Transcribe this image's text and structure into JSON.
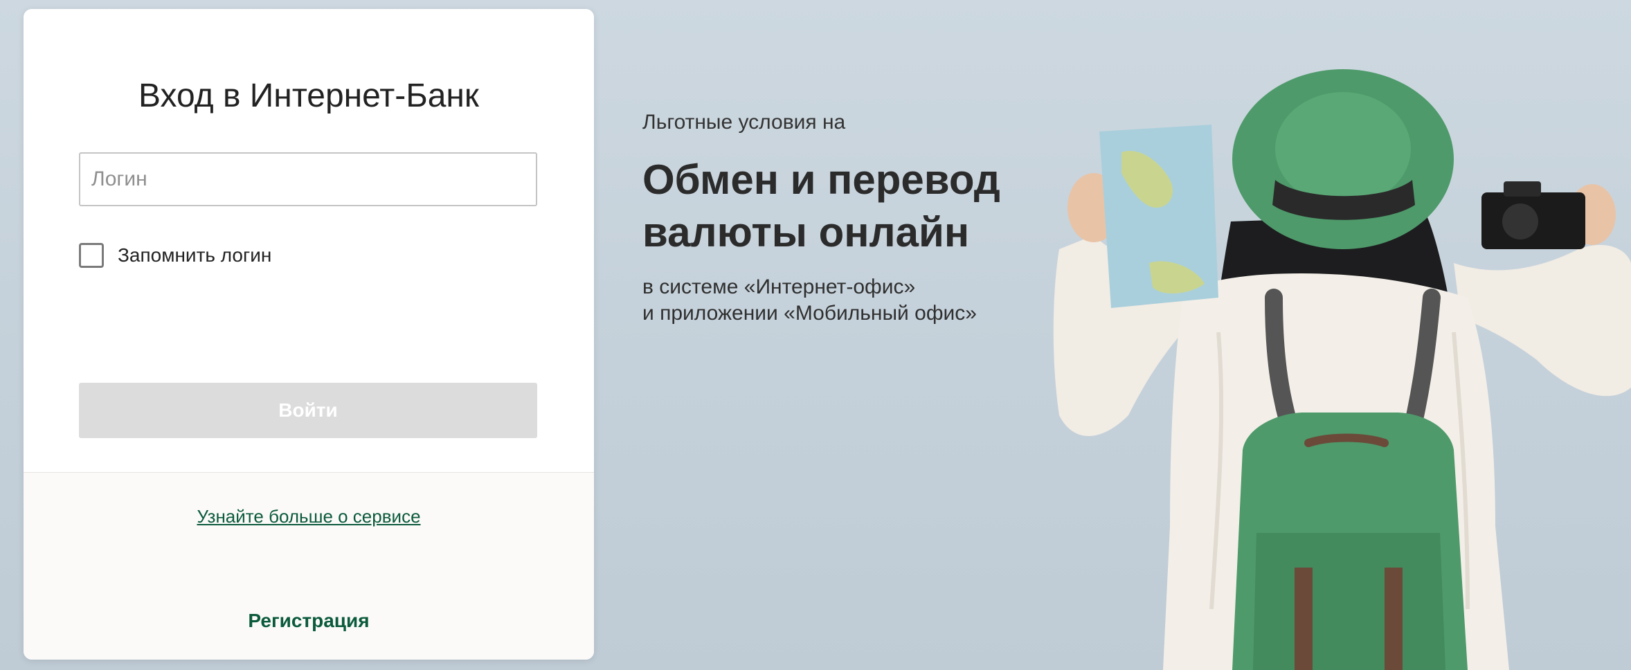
{
  "login": {
    "title": "Вход в Интернет-Банк",
    "login_placeholder": "Логин",
    "login_value": "",
    "remember_label": "Запомнить логин",
    "remember_checked": false,
    "submit_label": "Войти",
    "learn_more_link": "Узнайте больше о сервисе",
    "register_link": "Регистрация"
  },
  "promo": {
    "pretitle": "Льготные условия на",
    "title_line1": "Обмен и перевод",
    "title_line2": "валюты онлайн",
    "subtitle_line1": "в системе «Интернет-офис»",
    "subtitle_line2": "и приложении «Мобильный офис»",
    "image_icon": "traveler-with-backpack-illustration"
  },
  "colors": {
    "accent_green": "#0b5a3c",
    "button_disabled": "#dcdcdc",
    "background": "#cdd8e0",
    "hat_backpack_green": "#4e9a6a"
  }
}
